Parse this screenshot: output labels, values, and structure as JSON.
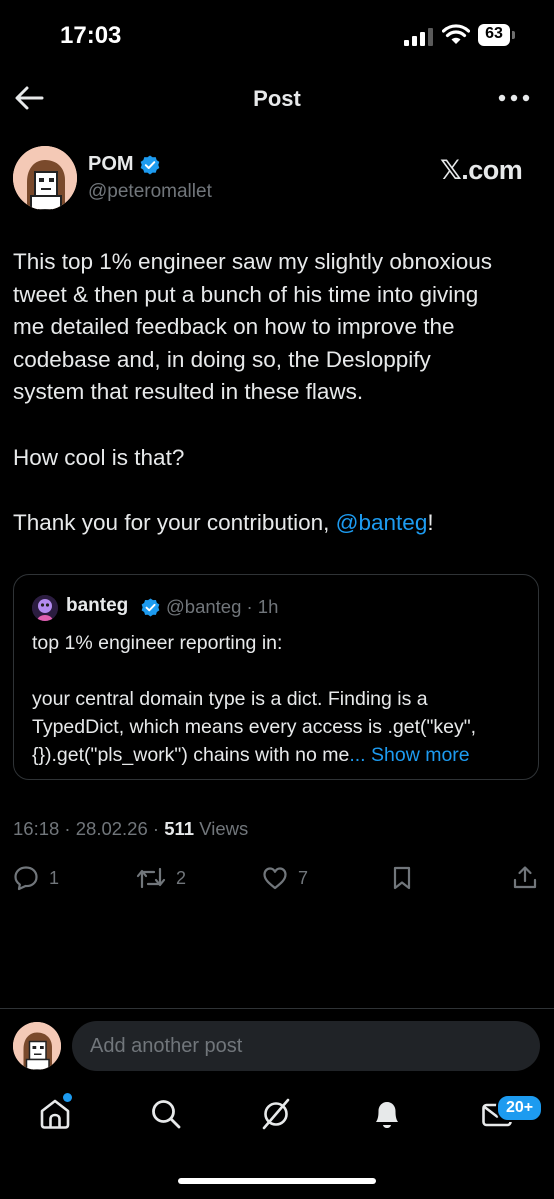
{
  "status_bar": {
    "time": "17:03",
    "battery": "63"
  },
  "header": {
    "title": "Post"
  },
  "post": {
    "author_name": "POM",
    "author_handle": "@peteromallet",
    "brand": "𝕏.com",
    "body_lines": [
      "This top 1% engineer saw my slightly obnoxious",
      "tweet & then put a bunch of his time into giving",
      "me detailed feedback on how to improve the",
      "codebase and, in doing so, the Desloppify",
      "system that resulted in these flaws."
    ],
    "body_question": "How cool is that?",
    "body_thanks_prefix": "Thank you for your contribution, ",
    "body_mention": "@banteg",
    "body_thanks_suffix": "!",
    "timestamp": "16:18 · 28.02.26 · ",
    "views_count": "511",
    "views_label": " Views"
  },
  "quote": {
    "name": "banteg",
    "handle_time": "@banteg · 1h",
    "line1": "top 1% engineer reporting in:",
    "line2": "your central domain type is a dict. Finding is a",
    "line3": "TypedDict, which means every access is .get(\"key\",",
    "line4": "{}).get(\"pls_work\") chains with no me",
    "show_more": "... Show more"
  },
  "actions": {
    "replies": "1",
    "reposts": "2",
    "likes": "7"
  },
  "reply_bar": {
    "placeholder": "Add another post"
  },
  "nav": {
    "notifications_badge": "20+"
  },
  "colors": {
    "accent": "#1d9bf0",
    "background": "#000000",
    "muted": "#71767b",
    "text": "#e7e9ea"
  }
}
